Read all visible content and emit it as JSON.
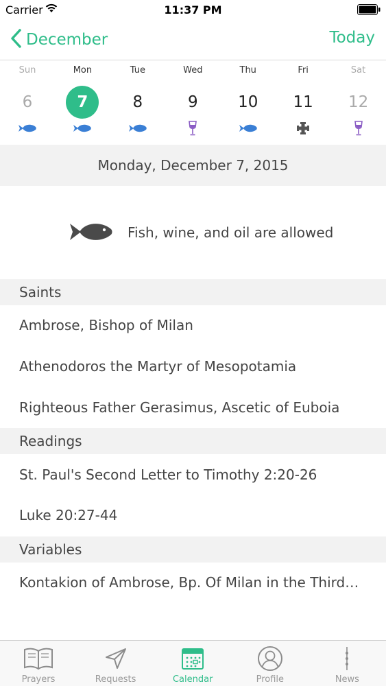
{
  "status_bar": {
    "carrier": "Carrier",
    "time": "11:37 PM"
  },
  "nav": {
    "back_label": "December",
    "today_label": "Today"
  },
  "week": [
    {
      "dow": "Sun",
      "num": "6",
      "fast": "fish-icon",
      "dim": true
    },
    {
      "dow": "Mon",
      "num": "7",
      "fast": "fish-icon",
      "selected": true
    },
    {
      "dow": "Tue",
      "num": "8",
      "fast": "fish-icon"
    },
    {
      "dow": "Wed",
      "num": "9",
      "fast": "wine-icon"
    },
    {
      "dow": "Thu",
      "num": "10",
      "fast": "fish-icon"
    },
    {
      "dow": "Fri",
      "num": "11",
      "fast": "cross-icon"
    },
    {
      "dow": "Sat",
      "num": "12",
      "fast": "wine-icon",
      "dim": true
    }
  ],
  "date_header": "Monday, December 7, 2015",
  "fast_info": "Fish, wine, and oil are allowed",
  "sections": {
    "saints": {
      "title": "Saints",
      "items": [
        "Ambrose, Bishop of Milan",
        "Athenodoros the Martyr of Mesopotamia",
        "Righteous Father Gerasimus, Ascetic of Euboia"
      ]
    },
    "readings": {
      "title": "Readings",
      "items": [
        "St. Paul's Second Letter to Timothy 2:20-26",
        "Luke 20:27-44"
      ]
    },
    "variables": {
      "title": "Variables",
      "items": [
        "Kontakion of Ambrose, Bp. Of Milan in the Third…"
      ]
    }
  },
  "tabs": [
    {
      "label": "Prayers",
      "icon": "book-icon"
    },
    {
      "label": "Requests",
      "icon": "send-icon"
    },
    {
      "label": "Calendar",
      "icon": "calendar-icon",
      "active": true
    },
    {
      "label": "Profile",
      "icon": "profile-icon"
    },
    {
      "label": "News",
      "icon": "news-icon"
    }
  ],
  "colors": {
    "accent": "#2fbd8a",
    "fish": "#3a7fd5",
    "wine": "#8a5cc4",
    "cross": "#555555"
  }
}
